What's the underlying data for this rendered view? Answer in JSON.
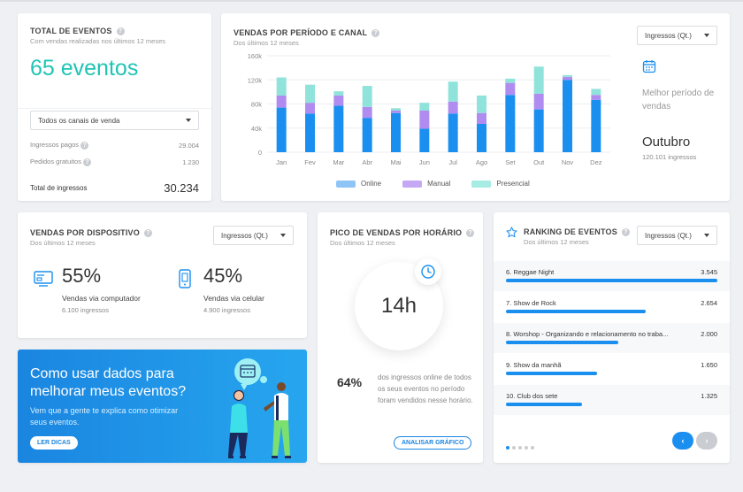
{
  "total": {
    "title": "TOTAL DE EVENTOS",
    "subtitle": "Com vendas realizadas nos últimos 12 meses",
    "count": "65 eventos",
    "select": "Todos os canais de venda",
    "paid_label": "Ingressos pagos",
    "paid_value": "29.004",
    "free_label": "Pedidos gratuitos",
    "free_value": "1.230",
    "total_label": "Total de ingressos",
    "total_value": "30.234"
  },
  "sales": {
    "title": "VENDAS POR PERÍODO E CANAL",
    "subtitle": "Dos últimos 12 meses",
    "select": "Ingressos (Qt.)",
    "best_label": "Melhor período de vendas",
    "best_month": "Outubro",
    "best_count": "120.101 ingressos"
  },
  "chart_data": {
    "type": "bar",
    "stacked": true,
    "categories": [
      "Jan",
      "Fev",
      "Mar",
      "Abr",
      "Mai",
      "Jun",
      "Jul",
      "Ago",
      "Set",
      "Out",
      "Nov",
      "Dez"
    ],
    "y_ticks": [
      "0",
      "40k",
      "80k",
      "120k",
      "160k"
    ],
    "ylim": [
      0,
      160000
    ],
    "series": [
      {
        "name": "Online",
        "color": "#1a8ff0",
        "values": [
          74000,
          64000,
          77000,
          57000,
          65000,
          39000,
          64000,
          47000,
          95000,
          71000,
          120000,
          87000
        ]
      },
      {
        "name": "Manual",
        "color": "#b08cf0",
        "values": [
          20000,
          18000,
          17000,
          18000,
          4000,
          30000,
          20000,
          18000,
          20000,
          26000,
          5000,
          8000
        ]
      },
      {
        "name": "Presencial",
        "color": "#8fe3da",
        "values": [
          30000,
          30000,
          7000,
          35000,
          4000,
          13000,
          33000,
          29000,
          7000,
          45000,
          3000,
          10000
        ]
      }
    ],
    "grid": true,
    "legend": "bottom"
  },
  "device": {
    "title": "VENDAS POR DISPOSITIVO",
    "subtitle": "Dos últimos 12 meses",
    "select": "Ingressos (Qt.)",
    "computer_pct": "55%",
    "computer_label": "Vendas via computador",
    "computer_sub": "6.100 ingressos",
    "mobile_pct": "45%",
    "mobile_label": "Vendas via celular",
    "mobile_sub": "4.900 ingressos"
  },
  "banner": {
    "title": "Como usar dados para melhorar meus eventos?",
    "subtitle": "Vem que a gente te explica como otimizar seus eventos.",
    "button": "LER DICAS"
  },
  "peak": {
    "title": "PICO DE VENDAS POR HORÁRIO",
    "subtitle": "Dos últimos 12 meses",
    "hour": "14h",
    "pct": "64%",
    "desc": "dos ingressos online de todos os seus eventos no período foram vendidos nesse horário.",
    "button": "ANALISAR GRÁFICO"
  },
  "ranking": {
    "title": "RANKING DE EVENTOS",
    "subtitle": "Dos últimos 12 meses",
    "select": "Ingressos (Qt.)",
    "items": [
      {
        "name": "6. Reggae Night",
        "value": "3.545",
        "fraction": 1.0
      },
      {
        "name": "7. Show de Rock",
        "value": "2.654",
        "fraction": 0.66
      },
      {
        "name": "8.  Worshop - Organizando e relacionamento no traba...",
        "value": "2.000",
        "fraction": 0.53
      },
      {
        "name": "9. Show da manhã",
        "value": "1.650",
        "fraction": 0.43
      },
      {
        "name": "10. Club dos sete",
        "value": "1.325",
        "fraction": 0.36
      }
    ],
    "prev": "‹",
    "next": "›"
  }
}
